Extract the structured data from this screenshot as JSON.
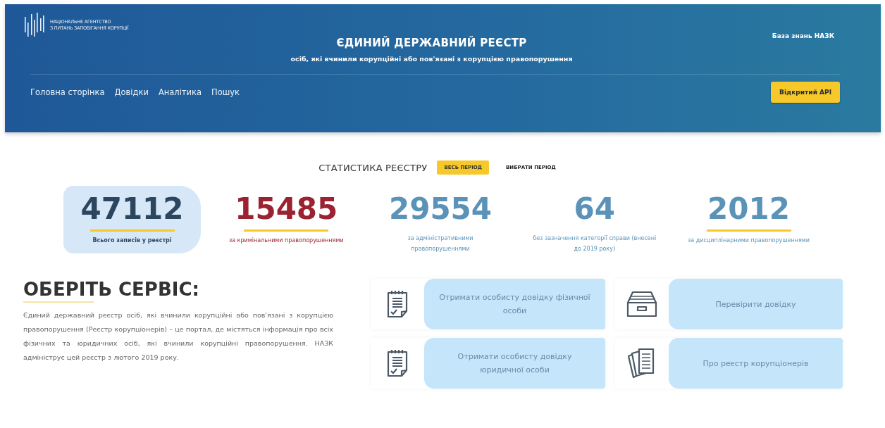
{
  "header": {
    "logo_lines": [
      "НАЦІОНАЛЬНЕ АГЕНТСТВО",
      "З ПИТАНЬ ЗАПОБІГАННЯ КОРУПЦІЇ"
    ],
    "top_link": "База знань НАЗК",
    "title": "ЄДИНИЙ ДЕРЖАВНИЙ РЕЄСТР",
    "subtitle": "осіб, які вчинили корупційні або пов'язані з корупцією правопорушення",
    "nav": [
      "Головна сторінка",
      "Довідки",
      "Аналітика",
      "Пошук"
    ],
    "api_button": "Відкритий API"
  },
  "statistics": {
    "title": "СТАТИСТИКА РЕЄСТРУ",
    "periods": [
      {
        "label": "ВЕСЬ ПЕРІОД",
        "selected": true
      },
      {
        "label": "ВИБРАТИ ПЕРІОД",
        "selected": false
      }
    ],
    "items": [
      {
        "value": "47112",
        "label": "Всього записів у реєстрі",
        "color": "#2d4660",
        "selected": true
      },
      {
        "value": "15485",
        "label": "за кримінальними правопорушеннями",
        "color": "#9b2231",
        "selected": false
      },
      {
        "value": "29554",
        "label": "за адміністративними правопорушеннями",
        "color": "#5b93b8",
        "selected": false
      },
      {
        "value": "64",
        "label": "без зазначення категорії справи (внесені до 2019 року)",
        "color": "#5b93b8",
        "selected": false
      },
      {
        "value": "2012",
        "label": "за дисциплінарними правопорушеннями",
        "color": "#5b93b8",
        "selected": false
      }
    ]
  },
  "services": {
    "title": "ОБЕРІТЬ СЕРВІС:",
    "description": "Єдиний державний реєстр осіб, які вчинили корупційні або пов'язані з корупцією правопорушення (Реєстр корупціонерів) – це портал, де містяться інформація про всіх фізичних та юридичних осіб, які вчинили корупційні правопорушення. НАЗК адмініструє цей реєстр з лютого 2019 року.",
    "cards": [
      {
        "kind": "clipboard",
        "label": "Отримати особисту довідку фізичної особи"
      },
      {
        "kind": "tray",
        "label": "Перевірити довідку"
      },
      {
        "kind": "clipboard",
        "label": "Отримати особисту довідку юридичної особи"
      },
      {
        "kind": "documents",
        "label": "Про реєстр корупціонерів"
      }
    ]
  }
}
